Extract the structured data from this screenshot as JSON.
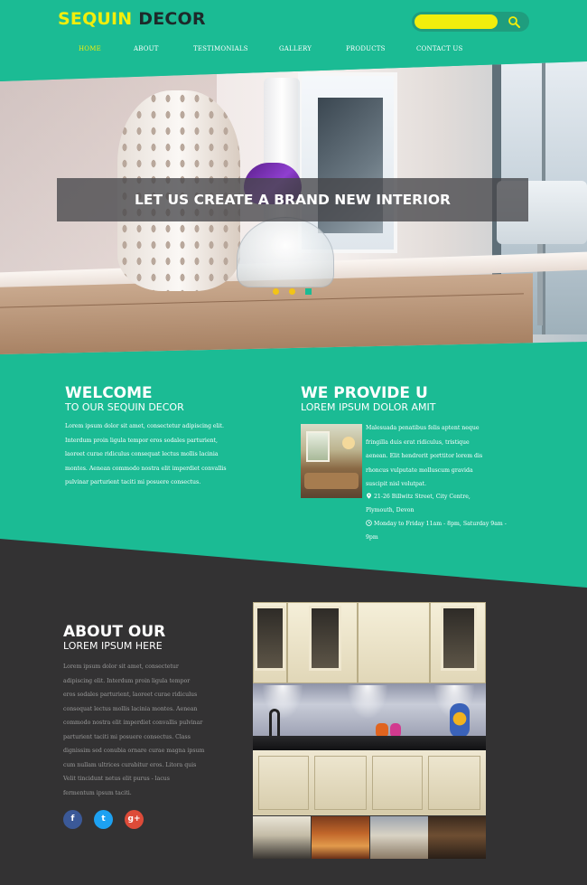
{
  "brand": {
    "word1": "SEQUIN",
    "word2": "DECOR"
  },
  "search": {
    "placeholder": "",
    "value": ""
  },
  "nav": {
    "items": [
      {
        "label": "HOME",
        "active": true
      },
      {
        "label": "ABOUT"
      },
      {
        "label": "TESTIMONIALS"
      },
      {
        "label": "GALLERY"
      },
      {
        "label": "PRODUCTS"
      },
      {
        "label": "CONTACT US"
      }
    ]
  },
  "hero": {
    "caption": "LET US CREATE A BRAND NEW INTERIOR",
    "slider_dots": 3,
    "active_dot": 3
  },
  "welcome": {
    "title": "WELCOME",
    "subtitle": "TO OUR SEQUIN DECOR",
    "lines": [
      "Lorem ipsum dolor sit amet, consectetur adipiscing elit.",
      "Interdum proin ligula tempor eros sodales parturient,",
      "laoreet curae ridiculus consequat lectus mollis lacinia",
      "montes. Aenean commodo nostra elit imperdiet convallis",
      "pulvinar parturient taciti mi posuere consectus."
    ]
  },
  "provide": {
    "title": "WE PROVIDE U",
    "subtitle": "LOREM IPSUM DOLOR AMIT",
    "lines": [
      "Malesuada penatibus felis aptent neque",
      "fringilla duis erat ridiculus, tristique",
      "aenean. Elit hendrerit porttitor lorem dis",
      "rhoncus vulputate molluscum gravida",
      "suscipit nisl volutpat."
    ],
    "address": "21-26 Billwitz Street, City Centre,",
    "address2": "Plymouth, Devon",
    "hours": "Monday to Friday 11am - 8pm, Saturday 9am -",
    "hours2": "9pm"
  },
  "about": {
    "title": "ABOUT OUR",
    "subtitle": "LOREM IPSUM HERE",
    "lines": [
      "Lorem ipsum dolor sit amet, consectetur",
      "adipiscing elit. Interdum proin ligula tempor",
      "eros sodales parturient, laoreet curae ridiculus",
      "consequat lectus mollis lacinia montes. Aenean",
      "commodo nostra elit imperdiet convallis pulvinar",
      "parturient taciti mi posuere consectus. Class",
      "dignissim sed conubia ornare curae magna ipsum",
      "cum nullam ultrices curabitur eros. Litora quis",
      "Velit tincidunt netus elit purus - lacus",
      "fermentum ipsum taciti."
    ]
  },
  "social": [
    {
      "icon": "facebook-icon",
      "glyph": "f",
      "color": "#3b5998"
    },
    {
      "icon": "twitter-icon",
      "glyph": "t",
      "color": "#1da1f2"
    },
    {
      "icon": "google-plus-icon",
      "glyph": "g+",
      "color": "#dd4b39"
    }
  ],
  "colors": {
    "teal": "#1bbb94",
    "yellow": "#f2ee0c",
    "dark": "#333233"
  }
}
